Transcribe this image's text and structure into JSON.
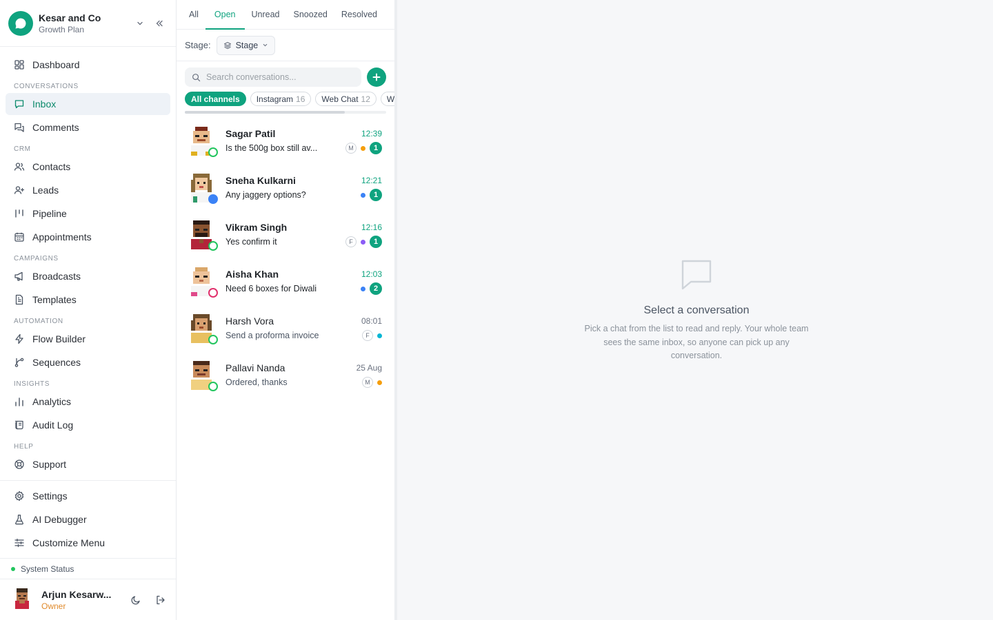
{
  "workspace": {
    "name": "Kesar and Co",
    "plan": "Growth Plan"
  },
  "sidebar": {
    "dashboard": "Dashboard",
    "sections": {
      "conversations": "CONVERSATIONS",
      "crm": "CRM",
      "campaigns": "CAMPAIGNS",
      "automation": "AUTOMATION",
      "insights": "INSIGHTS",
      "help": "HELP"
    },
    "items": {
      "inbox": "Inbox",
      "comments": "Comments",
      "contacts": "Contacts",
      "leads": "Leads",
      "pipeline": "Pipeline",
      "appointments": "Appointments",
      "broadcasts": "Broadcasts",
      "templates": "Templates",
      "flow_builder": "Flow Builder",
      "sequences": "Sequences",
      "analytics": "Analytics",
      "audit_log": "Audit Log",
      "support": "Support",
      "settings": "Settings",
      "ai_debugger": "AI Debugger",
      "customize_menu": "Customize Menu"
    },
    "system_status": "System Status",
    "user": {
      "name": "Arjun Kesarw...",
      "role": "Owner"
    }
  },
  "list": {
    "tabs": [
      "All",
      "Open",
      "Unread",
      "Snoozed",
      "Resolved"
    ],
    "active_tab": "Open",
    "stage_label": "Stage:",
    "stage_button": "Stage",
    "search_placeholder": "Search conversations...",
    "chips": [
      {
        "label": "All channels",
        "count": ""
      },
      {
        "label": "Instagram",
        "count": "16"
      },
      {
        "label": "Web Chat",
        "count": "12"
      },
      {
        "label": "W",
        "count": ""
      }
    ],
    "conversations": [
      {
        "name": "Sagar Patil",
        "time": "12:39",
        "message": "Is the 500g box still av...",
        "tag": "M",
        "dot_color": "#f59e0b",
        "unread": "1",
        "channel": "whatsapp"
      },
      {
        "name": "Sneha Kulkarni",
        "time": "12:21",
        "message": "Any jaggery options?",
        "tag": "",
        "dot_color": "#3b82f6",
        "unread": "1",
        "channel": "web"
      },
      {
        "name": "Vikram Singh",
        "time": "12:16",
        "message": "Yes confirm it",
        "tag": "F",
        "dot_color": "#8b5cf6",
        "unread": "1",
        "channel": "whatsapp"
      },
      {
        "name": "Aisha Khan",
        "time": "12:03",
        "message": "Need 6 boxes for Diwali",
        "tag": "",
        "dot_color": "#3b82f6",
        "unread": "2",
        "channel": "instagram"
      },
      {
        "name": "Harsh Vora",
        "time": "08:01",
        "message": "Send a proforma invoice",
        "tag": "F",
        "dot_color": "#06b6d4",
        "unread": "",
        "channel": "whatsapp"
      },
      {
        "name": "Pallavi Nanda",
        "time": "25 Aug",
        "message": "Ordered, thanks",
        "tag": "M",
        "dot_color": "#f59e0b",
        "unread": "",
        "channel": "whatsapp"
      }
    ]
  },
  "empty_state": {
    "title": "Select a conversation",
    "description": "Pick a chat from the list to read and reply. Your whole team sees the same inbox, so anyone can pick up any conversation."
  },
  "colors": {
    "accent": "#0fa37f",
    "owner": "#e08a2c"
  }
}
